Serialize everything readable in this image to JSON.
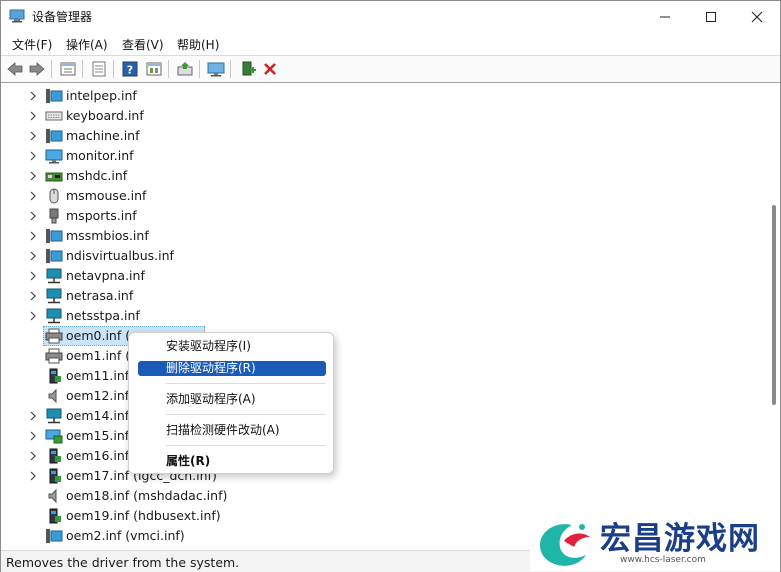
{
  "window": {
    "title": "设备管理器"
  },
  "menu": [
    "文件(F)",
    "操作(A)",
    "查看(V)",
    "帮助(H)"
  ],
  "toolbar": {
    "buttons": [
      "back-icon",
      "forward-icon",
      "properties-view-icon",
      "list-icon",
      "help-icon",
      "action-view-icon",
      "update-driver-icon",
      "monitor-scan-icon",
      "add-driver-icon",
      "delete-icon"
    ]
  },
  "tree": {
    "rows": [
      {
        "label": "intelpep.inf",
        "icon": "system-icon",
        "expandable": true
      },
      {
        "label": "keyboard.inf",
        "icon": "keyboard-icon",
        "expandable": true
      },
      {
        "label": "machine.inf",
        "icon": "system-icon",
        "expandable": true
      },
      {
        "label": "monitor.inf",
        "icon": "monitor-icon",
        "expandable": true
      },
      {
        "label": "mshdc.inf",
        "icon": "disk-controller-icon",
        "expandable": true
      },
      {
        "label": "msmouse.inf",
        "icon": "mouse-icon",
        "expandable": true
      },
      {
        "label": "msports.inf",
        "icon": "port-icon",
        "expandable": true
      },
      {
        "label": "mssmbios.inf",
        "icon": "system-icon",
        "expandable": true
      },
      {
        "label": "ndisvirtualbus.inf",
        "icon": "system-icon",
        "expandable": true
      },
      {
        "label": "netavpna.inf",
        "icon": "network-icon",
        "expandable": true
      },
      {
        "label": "netrasa.inf",
        "icon": "network-icon",
        "expandable": true
      },
      {
        "label": "netsstpa.inf",
        "icon": "network-icon",
        "expandable": true
      },
      {
        "label": "oem0.inf (p",
        "icon": "printer-icon",
        "expandable": false,
        "selected": true
      },
      {
        "label": "oem1.inf (p",
        "icon": "printer-icon",
        "expandable": false
      },
      {
        "label": "oem11.inf",
        "icon": "driver-package-icon",
        "expandable": false
      },
      {
        "label": "oem12.inf",
        "icon": "speaker-icon",
        "expandable": false
      },
      {
        "label": "oem14.inf",
        "icon": "network-icon",
        "expandable": true
      },
      {
        "label": "oem15.inf",
        "icon": "display-adapter-icon",
        "expandable": true
      },
      {
        "label": "oem16.inf",
        "icon": "driver-package-icon",
        "expandable": true
      },
      {
        "label": "oem17.inf (igcc_dch.inf)",
        "icon": "driver-package-icon",
        "expandable": true
      },
      {
        "label": "oem18.inf (mshdadac.inf)",
        "icon": "speaker-icon",
        "expandable": false
      },
      {
        "label": "oem19.inf (hdbusext.inf)",
        "icon": "driver-package-icon",
        "expandable": false
      },
      {
        "label": "oem2.inf (vmci.inf)",
        "icon": "system-icon",
        "expandable": false
      }
    ]
  },
  "context_menu": {
    "items": [
      {
        "label": "安装驱动程序(I)",
        "highlighted": false
      },
      {
        "label": "删除驱动程序(R)",
        "highlighted": true
      },
      {
        "label": "添加驱动程序(A)",
        "highlighted": false
      },
      {
        "label": "扫描检测硬件改动(A)",
        "highlighted": false
      },
      {
        "label": "属性(R)",
        "highlighted": false,
        "bold": true
      }
    ]
  },
  "status": {
    "text": "Removes the driver from the system."
  },
  "watermark": {
    "title": "宏昌游戏网",
    "url": "www.hcs-laser.com"
  },
  "colors": {
    "selection": "#cce4f7",
    "menu_highlight": "#1a5bb8",
    "delete_red": "#d42020",
    "network_teal": "#1d8fb0"
  }
}
